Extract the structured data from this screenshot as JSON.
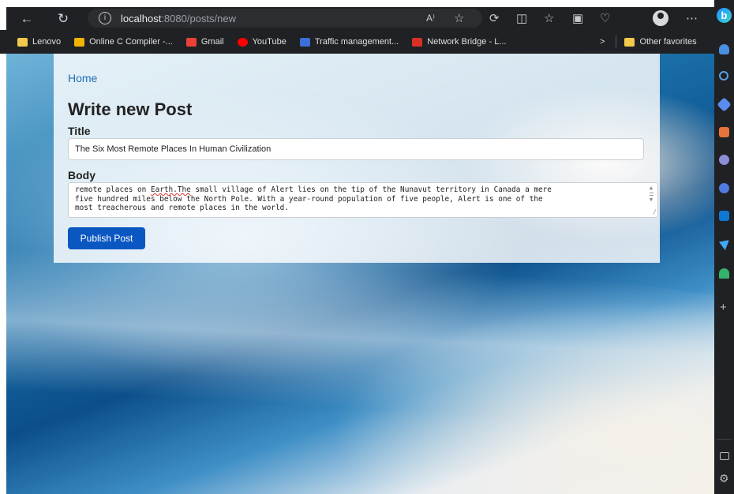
{
  "browser": {
    "url_host": "localhost",
    "url_path": ":8080/posts/new",
    "profile_icon": "profile-avatar-icon"
  },
  "favorites": [
    {
      "label": "Lenovo",
      "color": "#f2c94c"
    },
    {
      "label": "Online C Compiler -...",
      "color": "#f0b400"
    },
    {
      "label": "Gmail",
      "color": "#ea4335"
    },
    {
      "label": "YouTube",
      "color": "#ff0000"
    },
    {
      "label": "Traffic management...",
      "color": "#3b6fd8"
    },
    {
      "label": "Network Bridge - L...",
      "color": "#d93025"
    }
  ],
  "favorites_more": ">",
  "other_favorites": "Other favorites",
  "page": {
    "home_link": "Home",
    "heading": "Write new Post",
    "title_label": "Title",
    "title_value": "The Six Most Remote Places In Human Civilization",
    "body_label": "Body",
    "body_lines": [
      "remote places on Earth.The small village of Alert lies on the tip of the Nunavut territory in Canada a mere",
      "five hundred miles below the North Pole. With a year-round population of five people, Alert is one of the",
      "most treacherous and remote places in the world."
    ],
    "publish_button": "Publish Post"
  },
  "sidebar_icons": [
    "bing-icon",
    "bell-icon",
    "search-icon",
    "tag-icon",
    "briefcase-icon",
    "people-icon",
    "games-icon",
    "outlook-icon",
    "send-icon",
    "tree-icon",
    "add-icon",
    "panel-icon",
    "settings-icon"
  ]
}
